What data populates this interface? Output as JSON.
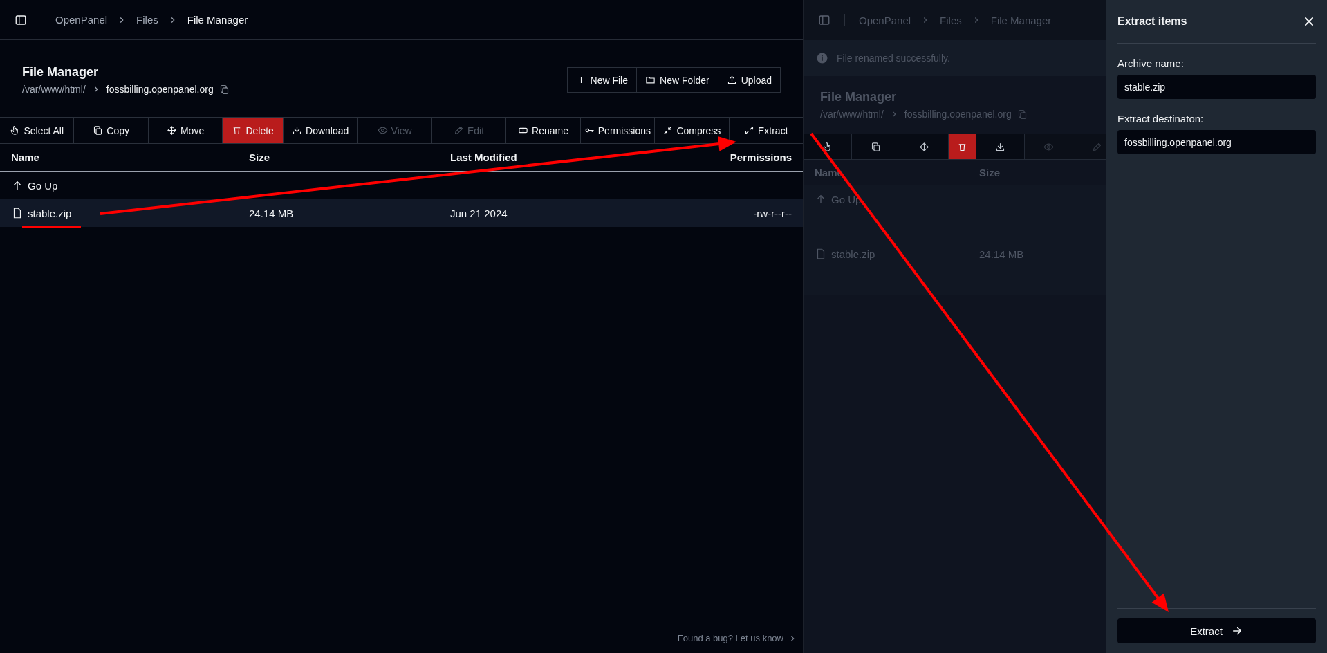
{
  "breadcrumbs": [
    "OpenPanel",
    "Files",
    "File Manager"
  ],
  "page": {
    "title": "File Manager",
    "path_parent": "/var/www/html/",
    "path_current": "fossbilling.openpanel.org"
  },
  "header_buttons": [
    "New File",
    "New Folder",
    "Upload"
  ],
  "toolbar": [
    {
      "label": "Select All",
      "kind": "normal",
      "disabled": false
    },
    {
      "label": "Copy",
      "kind": "normal",
      "disabled": false
    },
    {
      "label": "Move",
      "kind": "normal",
      "disabled": false
    },
    {
      "label": "Delete",
      "kind": "danger",
      "disabled": false
    },
    {
      "label": "Download",
      "kind": "normal",
      "disabled": false
    },
    {
      "label": "View",
      "kind": "normal",
      "disabled": true
    },
    {
      "label": "Edit",
      "kind": "normal",
      "disabled": true
    },
    {
      "label": "Rename",
      "kind": "normal",
      "disabled": false
    },
    {
      "label": "Permissions",
      "kind": "normal",
      "disabled": false
    },
    {
      "label": "Compress",
      "kind": "normal",
      "disabled": false
    },
    {
      "label": "Extract",
      "kind": "normal",
      "disabled": false
    }
  ],
  "table": {
    "columns": [
      "Name",
      "Size",
      "Last Modified",
      "Permissions"
    ],
    "go_up": "Go Up",
    "rows": [
      {
        "name": "stable.zip",
        "size": "24.14 MB",
        "modified": "Jun 21 2024",
        "permissions": "-rw-r--r--",
        "selected": true
      }
    ]
  },
  "footer_link": "Found a bug? Let us know",
  "background_view": {
    "breadcrumbs": [
      "OpenPanel",
      "Files",
      "File Manager"
    ],
    "notice": "File renamed successfully.",
    "title": "File Manager",
    "path_parent": "/var/www/html/",
    "path_current": "fossbilling.openpanel.org",
    "toolbar": [
      {
        "kind": "normal",
        "disabled": false
      },
      {
        "kind": "normal",
        "disabled": false
      },
      {
        "kind": "normal",
        "disabled": false
      },
      {
        "kind": "danger",
        "disabled": false
      },
      {
        "kind": "normal",
        "disabled": false
      },
      {
        "kind": "normal",
        "disabled": true
      },
      {
        "kind": "normal",
        "disabled": true
      }
    ],
    "columns": [
      "Name",
      "Size"
    ],
    "go_up": "Go Up",
    "rows": [
      {
        "name": "stable.zip",
        "size": "24.14 MB"
      }
    ]
  },
  "sheet": {
    "title": "Extract items",
    "fields": [
      {
        "label": "Archive name:",
        "value": "stable.zip"
      },
      {
        "label": "Extract destinaton:",
        "value": "fossbilling.openpanel.org"
      }
    ],
    "submit": "Extract"
  }
}
